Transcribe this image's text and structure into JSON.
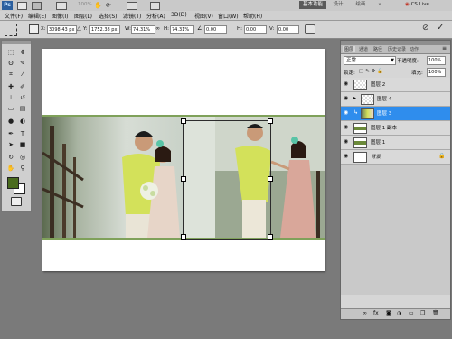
{
  "menubar": {
    "ps_logo": "Ps",
    "zoom": "100%",
    "items": [
      "文件(F)",
      "编辑(E)",
      "图像(I)",
      "图层(L)",
      "选择(S)",
      "滤镜(T)",
      "分析(A)",
      "3D(D)",
      "视图(V)",
      "窗口(W)",
      "帮助(H)"
    ],
    "workspace_active": "基本功能",
    "workspace_options": [
      "设计",
      "绘画"
    ],
    "cs_live": "CS Live"
  },
  "options": {
    "x_label": "X:",
    "x_value": "3098.43 px",
    "y_label": "Y:",
    "y_value": "1752.38 px",
    "w_label": "W:",
    "w_value": "74.31%",
    "h_label": "H:",
    "h_value": "74.31%",
    "rot_value": "0.00",
    "h2_label": "H:",
    "h2_value": "0.00",
    "v_label": "V:",
    "v_value": "0.00"
  },
  "tools": {
    "icons": [
      "move-tool",
      "marquee-tool",
      "lasso-tool",
      "quick-select-tool",
      "crop-tool",
      "eyedropper-tool",
      "spot-heal-tool",
      "brush-tool",
      "stamp-tool",
      "history-brush-tool",
      "eraser-tool",
      "gradient-tool",
      "blur-tool",
      "dodge-tool",
      "pen-tool",
      "type-tool",
      "path-select-tool",
      "shape-tool",
      "3d-rotate-tool",
      "3d-orbit-tool",
      "hand-tool",
      "zoom-tool"
    ],
    "foreground_color": "#4a6b1e",
    "background_color": "#ffffff"
  },
  "layers_panel": {
    "tabs": [
      "图层",
      "通道",
      "路径",
      "历史记录",
      "动作"
    ],
    "blend_mode": "正常",
    "opacity_label": "不透明度:",
    "opacity_value": "100%",
    "lock_label": "锁定:",
    "fill_label": "填充:",
    "fill_value": "100%",
    "layers": [
      {
        "name": "图层 2",
        "visible": true,
        "selected": false
      },
      {
        "name": "图层 4",
        "visible": true,
        "selected": false
      },
      {
        "name": "图层 3",
        "visible": true,
        "selected": true
      },
      {
        "name": "图层 1 副本",
        "visible": true,
        "selected": false
      },
      {
        "name": "图层 1",
        "visible": true,
        "selected": false
      },
      {
        "name": "背景",
        "visible": true,
        "selected": false
      }
    ]
  },
  "colors": {
    "panel_bg": "#d6d6d6",
    "selected_layer": "#2f8ded",
    "canvas_bg": "#7a7a7a",
    "green_line": "#7fa15a"
  }
}
